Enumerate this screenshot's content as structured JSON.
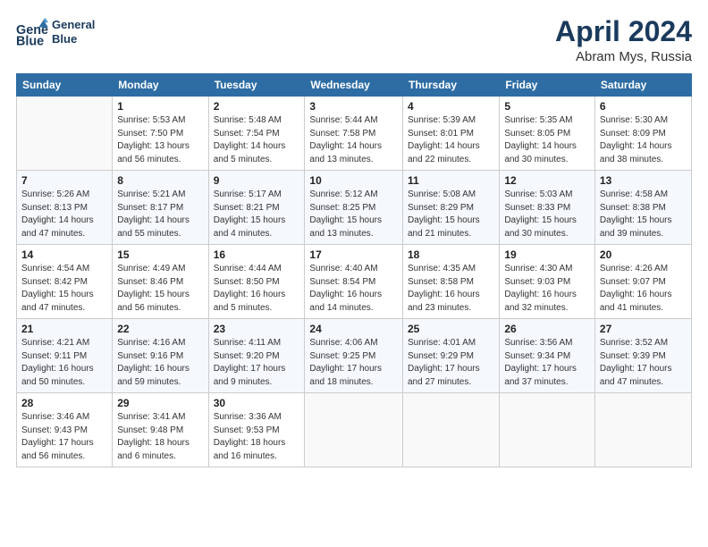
{
  "header": {
    "monthTitle": "April 2024",
    "location": "Abram Mys, Russia"
  },
  "columns": [
    "Sunday",
    "Monday",
    "Tuesday",
    "Wednesday",
    "Thursday",
    "Friday",
    "Saturday"
  ],
  "weeks": [
    [
      {
        "day": "",
        "info": ""
      },
      {
        "day": "1",
        "info": "Sunrise: 5:53 AM\nSunset: 7:50 PM\nDaylight: 13 hours\nand 56 minutes."
      },
      {
        "day": "2",
        "info": "Sunrise: 5:48 AM\nSunset: 7:54 PM\nDaylight: 14 hours\nand 5 minutes."
      },
      {
        "day": "3",
        "info": "Sunrise: 5:44 AM\nSunset: 7:58 PM\nDaylight: 14 hours\nand 13 minutes."
      },
      {
        "day": "4",
        "info": "Sunrise: 5:39 AM\nSunset: 8:01 PM\nDaylight: 14 hours\nand 22 minutes."
      },
      {
        "day": "5",
        "info": "Sunrise: 5:35 AM\nSunset: 8:05 PM\nDaylight: 14 hours\nand 30 minutes."
      },
      {
        "day": "6",
        "info": "Sunrise: 5:30 AM\nSunset: 8:09 PM\nDaylight: 14 hours\nand 38 minutes."
      }
    ],
    [
      {
        "day": "7",
        "info": "Sunrise: 5:26 AM\nSunset: 8:13 PM\nDaylight: 14 hours\nand 47 minutes."
      },
      {
        "day": "8",
        "info": "Sunrise: 5:21 AM\nSunset: 8:17 PM\nDaylight: 14 hours\nand 55 minutes."
      },
      {
        "day": "9",
        "info": "Sunrise: 5:17 AM\nSunset: 8:21 PM\nDaylight: 15 hours\nand 4 minutes."
      },
      {
        "day": "10",
        "info": "Sunrise: 5:12 AM\nSunset: 8:25 PM\nDaylight: 15 hours\nand 13 minutes."
      },
      {
        "day": "11",
        "info": "Sunrise: 5:08 AM\nSunset: 8:29 PM\nDaylight: 15 hours\nand 21 minutes."
      },
      {
        "day": "12",
        "info": "Sunrise: 5:03 AM\nSunset: 8:33 PM\nDaylight: 15 hours\nand 30 minutes."
      },
      {
        "day": "13",
        "info": "Sunrise: 4:58 AM\nSunset: 8:38 PM\nDaylight: 15 hours\nand 39 minutes."
      }
    ],
    [
      {
        "day": "14",
        "info": "Sunrise: 4:54 AM\nSunset: 8:42 PM\nDaylight: 15 hours\nand 47 minutes."
      },
      {
        "day": "15",
        "info": "Sunrise: 4:49 AM\nSunset: 8:46 PM\nDaylight: 15 hours\nand 56 minutes."
      },
      {
        "day": "16",
        "info": "Sunrise: 4:44 AM\nSunset: 8:50 PM\nDaylight: 16 hours\nand 5 minutes."
      },
      {
        "day": "17",
        "info": "Sunrise: 4:40 AM\nSunset: 8:54 PM\nDaylight: 16 hours\nand 14 minutes."
      },
      {
        "day": "18",
        "info": "Sunrise: 4:35 AM\nSunset: 8:58 PM\nDaylight: 16 hours\nand 23 minutes."
      },
      {
        "day": "19",
        "info": "Sunrise: 4:30 AM\nSunset: 9:03 PM\nDaylight: 16 hours\nand 32 minutes."
      },
      {
        "day": "20",
        "info": "Sunrise: 4:26 AM\nSunset: 9:07 PM\nDaylight: 16 hours\nand 41 minutes."
      }
    ],
    [
      {
        "day": "21",
        "info": "Sunrise: 4:21 AM\nSunset: 9:11 PM\nDaylight: 16 hours\nand 50 minutes."
      },
      {
        "day": "22",
        "info": "Sunrise: 4:16 AM\nSunset: 9:16 PM\nDaylight: 16 hours\nand 59 minutes."
      },
      {
        "day": "23",
        "info": "Sunrise: 4:11 AM\nSunset: 9:20 PM\nDaylight: 17 hours\nand 9 minutes."
      },
      {
        "day": "24",
        "info": "Sunrise: 4:06 AM\nSunset: 9:25 PM\nDaylight: 17 hours\nand 18 minutes."
      },
      {
        "day": "25",
        "info": "Sunrise: 4:01 AM\nSunset: 9:29 PM\nDaylight: 17 hours\nand 27 minutes."
      },
      {
        "day": "26",
        "info": "Sunrise: 3:56 AM\nSunset: 9:34 PM\nDaylight: 17 hours\nand 37 minutes."
      },
      {
        "day": "27",
        "info": "Sunrise: 3:52 AM\nSunset: 9:39 PM\nDaylight: 17 hours\nand 47 minutes."
      }
    ],
    [
      {
        "day": "28",
        "info": "Sunrise: 3:46 AM\nSunset: 9:43 PM\nDaylight: 17 hours\nand 56 minutes."
      },
      {
        "day": "29",
        "info": "Sunrise: 3:41 AM\nSunset: 9:48 PM\nDaylight: 18 hours\nand 6 minutes."
      },
      {
        "day": "30",
        "info": "Sunrise: 3:36 AM\nSunset: 9:53 PM\nDaylight: 18 hours\nand 16 minutes."
      },
      {
        "day": "",
        "info": ""
      },
      {
        "day": "",
        "info": ""
      },
      {
        "day": "",
        "info": ""
      },
      {
        "day": "",
        "info": ""
      }
    ]
  ]
}
